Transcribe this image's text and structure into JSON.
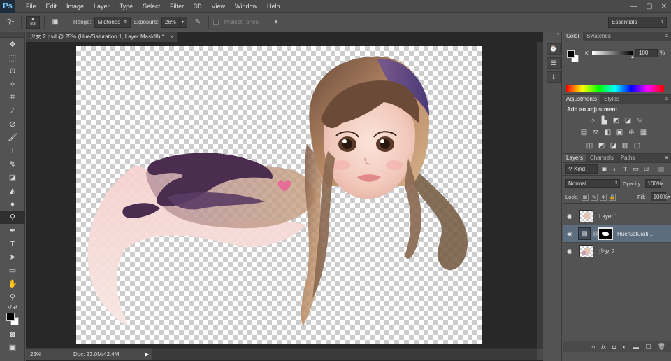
{
  "app": {
    "logo": "Ps",
    "menu": [
      "File",
      "Edit",
      "Image",
      "Layer",
      "Type",
      "Select",
      "Filter",
      "3D",
      "View",
      "Window",
      "Help"
    ],
    "window_controls": [
      "—",
      "▢",
      "✕"
    ]
  },
  "options": {
    "brush_size": "83",
    "range_label": "Range:",
    "range_value": "Midtones",
    "exposure_label": "Exposure:",
    "exposure_value": "26%",
    "protect_tones_label": "Protect Tones",
    "workspace": "Essentials"
  },
  "document": {
    "tab_title": "少女 2.psd @ 25% (Hue/Saturation 1, Layer Mask/8) *",
    "zoom": "25%",
    "doc_size": "Doc: 23.0M/42.4M"
  },
  "panels": {
    "color": {
      "tabs": [
        "Color",
        "Swatches"
      ],
      "channel_label": "K",
      "channel_value": "100",
      "unit": "%",
      "slider_fraction": 1.0
    },
    "adjustments": {
      "tabs": [
        "Adjustments",
        "Styles"
      ],
      "title": "Add an adjustment"
    },
    "layers": {
      "tabs": [
        "Layers",
        "Channels",
        "Paths"
      ],
      "filter_kind": "Kind",
      "blend_mode": "Normal",
      "opacity_label": "Opacity:",
      "opacity_value": "100%",
      "lock_label": "Lock:",
      "fill_label": "Fill:",
      "fill_value": "100%",
      "items": [
        {
          "name": "Layer 1",
          "type": "pixel",
          "selected": false
        },
        {
          "name": "Hue/Saturati...",
          "type": "adjustment",
          "selected": true
        },
        {
          "name": "少女 2",
          "type": "pixel",
          "selected": false
        }
      ]
    }
  },
  "colors": {
    "accent_selected_layer": "#5d6d80",
    "panel_bg": "#535353",
    "canvas_bg": "#282828"
  }
}
